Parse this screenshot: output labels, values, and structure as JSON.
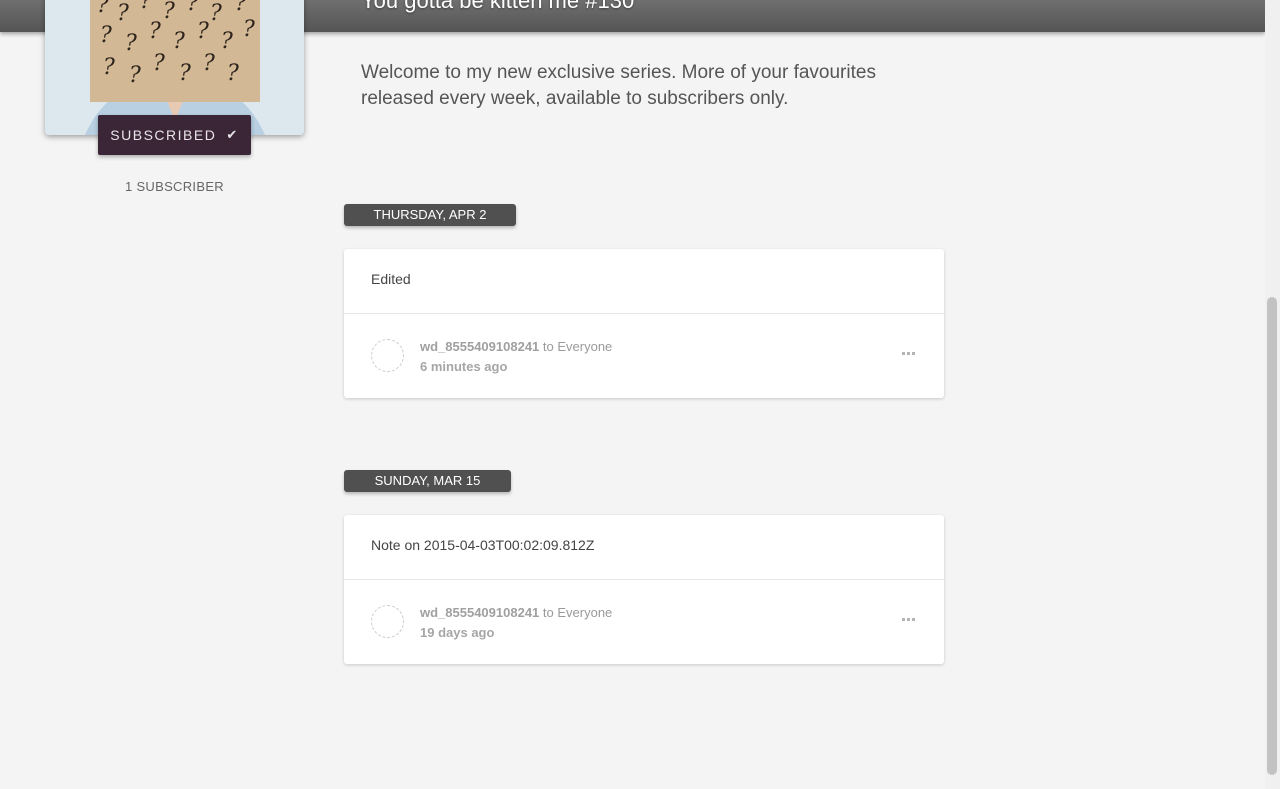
{
  "header": {
    "title": "You gotta be kitten me #130"
  },
  "profile": {
    "subscribe_label": "SUBSCRIBED",
    "subscribe_icon": "check-icon",
    "subscriber_count": "1 SUBSCRIBER"
  },
  "intro": {
    "text": "Welcome to my new exclusive series. More of your favourites released every week, available to subscribers only."
  },
  "feed": {
    "groups": [
      {
        "date": "THURSDAY, APR 2",
        "post": {
          "text": "Edited",
          "author": "wd_8555409108241",
          "audience": "to Everyone",
          "time": "6 minutes ago"
        }
      },
      {
        "date": "SUNDAY, MAR 15",
        "post": {
          "text": "Note on 2015-04-03T00:02:09.812Z",
          "author": "wd_8555409108241",
          "audience": "to Everyone",
          "time": "19 days ago"
        }
      }
    ]
  },
  "colors": {
    "header_bg": "#5f5f5f",
    "button_bg": "#3b2638",
    "date_chip_bg": "#505050",
    "page_bg": "#f4f4f4"
  }
}
